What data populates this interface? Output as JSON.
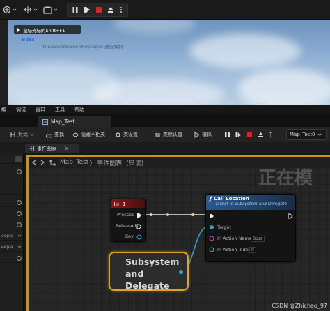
{
  "toolbar": {
    "play_tooltip": "",
    "icons": [
      "blueprint-add-icon",
      "transform-icon",
      "camera-icon",
      "pause-icon",
      "skip-icon",
      "stop-icon",
      "eject-icon",
      "more-icon"
    ]
  },
  "viewport": {
    "hint_label": "鼠标光标的Shift+F1",
    "boss_text": "Boss",
    "disable_text": "'DisableAllScreenMessages'进行抑制"
  },
  "menubar": {
    "items": [
      "编",
      "调试",
      "窗口",
      "工具",
      "帮助"
    ]
  },
  "document_tab": {
    "label": "Map_Test"
  },
  "bp_toolbar": {
    "compare_label": "对比",
    "find_label": "查找",
    "hide_label": "隐藏不相关",
    "class_settings_label": "类设置",
    "class_defaults_label": "类默认值",
    "simulate_label": "模拟",
    "map_select_value": "Map_Test0"
  },
  "panel_tab": {
    "label": "事件图表"
  },
  "left_panel": {
    "rows": [
      "",
      "",
      "",
      "",
      "",
      "",
      "eepla",
      "eepla",
      ""
    ]
  },
  "graph": {
    "breadcrumb_map": "Map_Test",
    "breadcrumb_sep": "〉",
    "breadcrumb_graph": "事件图表",
    "breadcrumb_readonly": "(只读)",
    "watermark": "正在模"
  },
  "key_node": {
    "title": "1",
    "pins": [
      "Pressed",
      "Released",
      "Key"
    ]
  },
  "call_node": {
    "title": "Call Location",
    "subtitle": "Target is Subsystem and Delegate",
    "target_label": "Target",
    "action_name_label": "In Action Name",
    "action_name_value": "Boss",
    "action_index_label": "In Action Index",
    "action_index_value": "0"
  },
  "subsystem_node": {
    "line1": "Subsystem",
    "line2": "and",
    "line3": "Delegate"
  },
  "credit": {
    "text": "CSDN @Zhichao_97"
  },
  "colors": {
    "accent": "#c9901a",
    "exec_wire": "#e8e8e8",
    "data_wire": "#2aa4c9",
    "key_header": "#8a1717",
    "call_header": "#2a5a8f",
    "stop_red": "#d22"
  }
}
